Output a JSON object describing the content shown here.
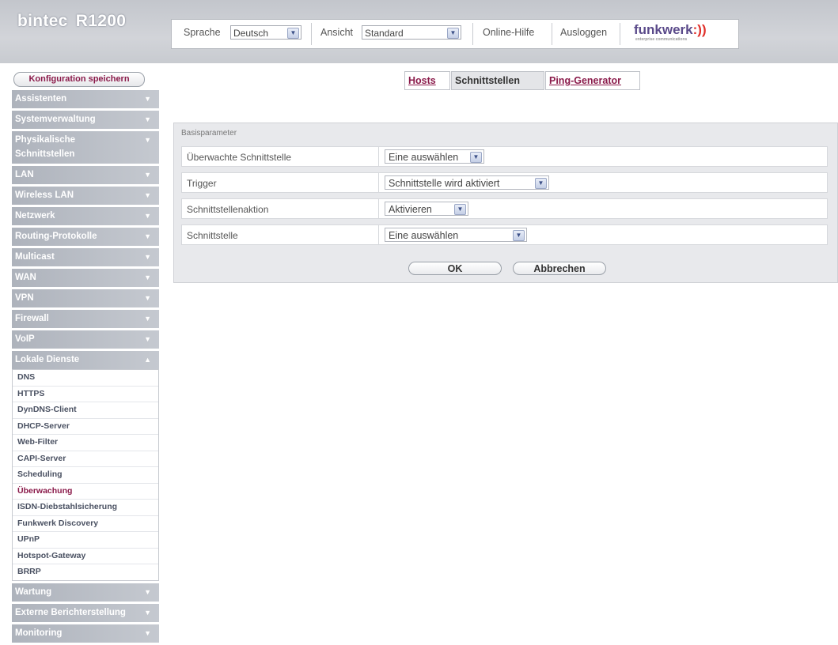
{
  "header": {
    "brand": "bintec",
    "model": "R1200",
    "language_label": "Sprache",
    "language_value": "Deutsch",
    "view_label": "Ansicht",
    "view_value": "Standard",
    "help_link": "Online-Hilfe",
    "logout_link": "Ausloggen",
    "logo_text": "funkwerk",
    "logo_mark": ":))",
    "logo_tagline": "enterprise communications"
  },
  "sidebar": {
    "save_label": "Konfiguration speichern",
    "items": [
      {
        "label": "Assistenten"
      },
      {
        "label": "Systemverwaltung"
      },
      {
        "label": "Physikalische Schnittstellen"
      },
      {
        "label": "LAN"
      },
      {
        "label": "Wireless LAN"
      },
      {
        "label": "Netzwerk"
      },
      {
        "label": "Routing-Protokolle"
      },
      {
        "label": "Multicast"
      },
      {
        "label": "WAN"
      },
      {
        "label": "VPN"
      },
      {
        "label": "Firewall"
      },
      {
        "label": "VoIP"
      },
      {
        "label": "Lokale Dienste"
      }
    ],
    "sub_items": [
      "DNS",
      "HTTPS",
      "DynDNS-Client",
      "DHCP-Server",
      "Web-Filter",
      "CAPI-Server",
      "Scheduling",
      "Überwachung",
      "ISDN-Diebstahlsicherung",
      "Funkwerk Discovery",
      "UPnP",
      "Hotspot-Gateway",
      "BRRP"
    ],
    "active_sub": "Überwachung",
    "bottom_items": [
      {
        "label": "Wartung"
      },
      {
        "label": "Externe Berichterstellung"
      },
      {
        "label": "Monitoring"
      }
    ]
  },
  "tabs": [
    {
      "label": "Hosts",
      "active": false
    },
    {
      "label": "Schnittstellen",
      "active": true
    },
    {
      "label": "Ping-Generator",
      "active": false
    }
  ],
  "form": {
    "section_title": "Basisparameter",
    "rows": [
      {
        "label": "Überwachte Schnittstelle",
        "value": "Eine auswählen"
      },
      {
        "label": "Trigger",
        "value": "Schnittstelle wird aktiviert"
      },
      {
        "label": "Schnittstellenaktion",
        "value": "Aktivieren"
      },
      {
        "label": "Schnittstelle",
        "value": "Eine auswählen"
      }
    ],
    "ok_label": "OK",
    "cancel_label": "Abbrechen"
  },
  "colors": {
    "accent": "#8a1a4a",
    "nav_bg": "#b6bac2",
    "header_bg": "#c8cbd0"
  }
}
